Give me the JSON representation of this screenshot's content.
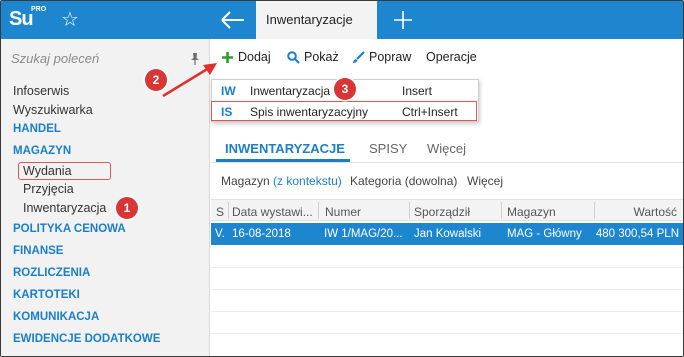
{
  "app": {
    "logo_text": "Su",
    "logo_badge": "PRO"
  },
  "topbar": {
    "active_tab": "Inwentaryzacje"
  },
  "sidebar": {
    "search_placeholder": "Szukaj poleceń",
    "items": [
      {
        "label": "Infoserwis"
      },
      {
        "label": "Wyszukiwarka"
      },
      {
        "label": "HANDEL"
      },
      {
        "label": "MAGAZYN"
      },
      {
        "label": "Wydania"
      },
      {
        "label": "Przyjęcia"
      },
      {
        "label": "Inwentaryzacja"
      },
      {
        "label": "POLITYKA CENOWA"
      },
      {
        "label": "FINANSE"
      },
      {
        "label": "ROZLICZENIA"
      },
      {
        "label": "KARTOTEKI"
      },
      {
        "label": "KOMUNIKACJA"
      },
      {
        "label": "EWIDENCJE DODATKOWE"
      }
    ]
  },
  "toolbar": {
    "add": "Dodaj",
    "show": "Pokaż",
    "edit": "Popraw",
    "ops": "Operacje"
  },
  "dropdown": {
    "items": [
      {
        "code": "IW",
        "label": "Inwentaryzacja",
        "shortcut": "Insert"
      },
      {
        "code": "IS",
        "label": "Spis inwentaryzacyjny",
        "shortcut": "Ctrl+Insert"
      }
    ]
  },
  "subtabs": {
    "t1": "INWENTARYZACJE",
    "t2": "SPISY",
    "t3": "Więcej"
  },
  "filters": {
    "magazyn": "Magazyn",
    "magazyn_val": "(z kontekstu)",
    "kategoria": "Kategoria (dowolna)",
    "more": "Więcej"
  },
  "grid": {
    "headers": [
      "S",
      "Data wystawi...",
      "Numer",
      "Sporządził",
      "Magazyn",
      "Wartość"
    ],
    "rows": [
      [
        "V.",
        "16-08-2018",
        "IW 1/MAG/20...",
        "Jan Kowalski",
        "MAG - Główny",
        "480 300,54 PLN"
      ]
    ]
  },
  "callouts": {
    "c1": "1",
    "c2": "2",
    "c3": "3"
  },
  "colors": {
    "accent": "#1d86cf",
    "highlight": "#e25555"
  }
}
